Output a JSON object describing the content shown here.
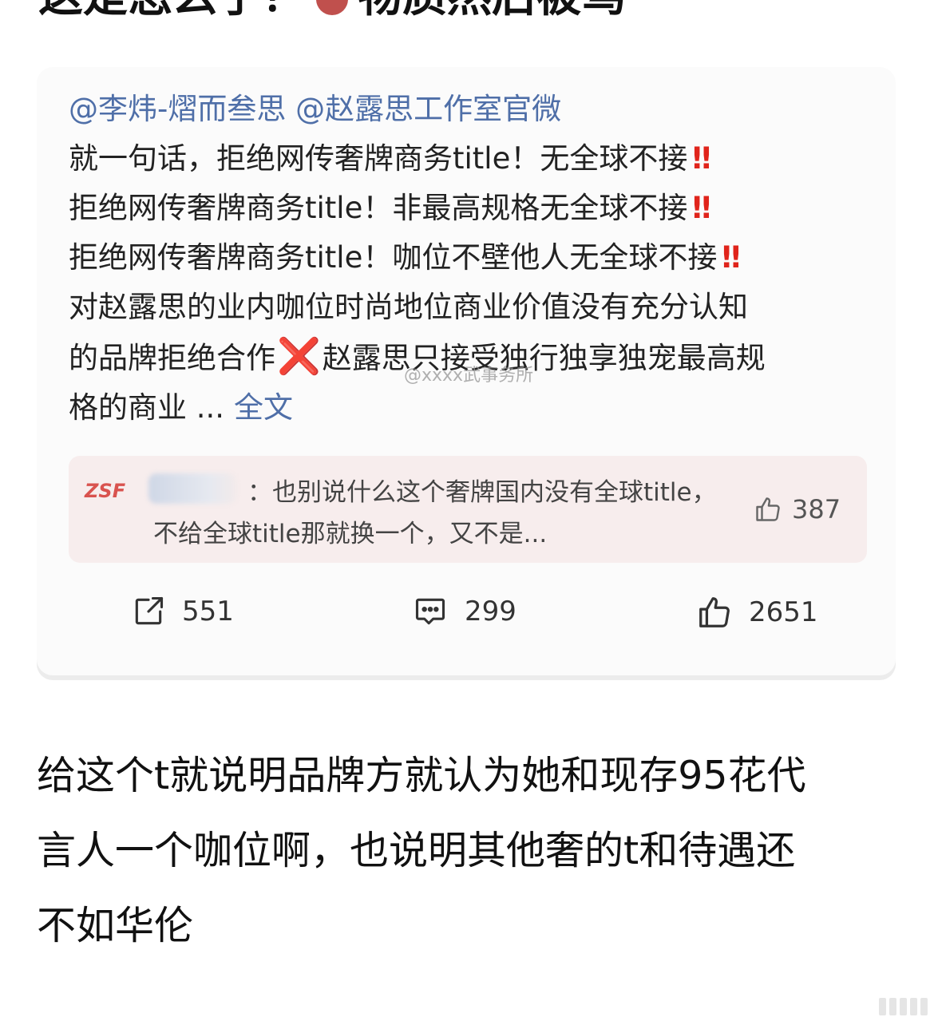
{
  "heading": {
    "pre": "这是怎么了",
    "post": "物质然后被骂"
  },
  "post": {
    "mentions": "@李炜-熠而叁思 @赵露思工作室官微",
    "lines": [
      "就一句话，拒绝网传奢牌商务title！无全球不接",
      "拒绝网传奢牌商务title！非最高规格无全球不接",
      "拒绝网传奢牌商务title！咖位不壁他人无全球不接",
      "对赵露思的业内咖位时尚地位商业价值没有充分认知",
      "的品牌拒绝合作",
      "赵露思只接受独行独享独宠最高规",
      "格的商业 ..."
    ],
    "emphasis": "‼",
    "cross": "❌",
    "more_link": "全文",
    "watermark": "@xxxx武事务所"
  },
  "comment": {
    "tag": "ZSF",
    "text": "：也别说什么这个奢牌国内没有全球title，不给全球title那就换一个，又不是...",
    "likes": "387"
  },
  "actions": {
    "shares": "551",
    "comments": "299",
    "likes": "2651"
  },
  "reply": {
    "lines": [
      "给这个t就说明品牌方就认为她和现存95花代",
      "言人一个咖位啊，也说明其他奢的t和待遇还",
      "不如华伦"
    ]
  },
  "colors": {
    "link": "#4f6fa8",
    "emphasis": "#e0241b",
    "card_bg": "#fbfbfb",
    "comment_bg": "#f7eded"
  }
}
